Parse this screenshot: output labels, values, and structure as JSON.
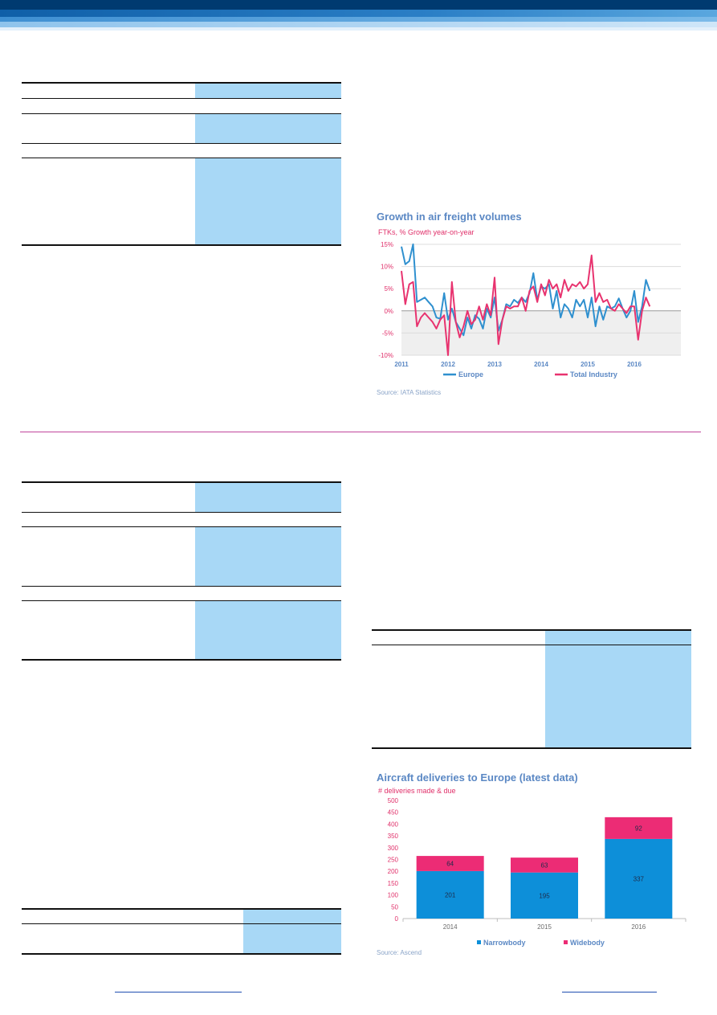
{
  "page_header": {
    "colors": {
      "navy": "#003a70",
      "mid_blue": "#1a6fb8",
      "light_blue": "#56a3dc",
      "pale_blue": "#a9d3f1"
    }
  },
  "freight_chart": {
    "title": "Growth in air freight volumes",
    "subtitle": "FTKs, % Growth year-on-year",
    "source": "Source: IATA Statistics",
    "legend": [
      "Europe",
      "Total Industry"
    ]
  },
  "deliveries_chart": {
    "title": "Aircraft deliveries to Europe (latest data)",
    "subtitle": "# deliveries made & due",
    "source": "Source: Ascend",
    "legend": [
      "Narrowbody",
      "Widebody"
    ]
  },
  "chart_data": [
    {
      "type": "line",
      "title": "Growth in air freight volumes",
      "subtitle": "FTKs, % Growth year-on-year",
      "x_ticks": [
        "2011",
        "2012",
        "2013",
        "2014",
        "2015",
        "2016"
      ],
      "y_ticks": [
        "15%",
        "10%",
        "5%",
        "0%",
        "-5%",
        "-10%"
      ],
      "ylim": [
        -10,
        15
      ],
      "xlim": [
        2011,
        2017
      ],
      "grid": true,
      "legend_position": "bottom",
      "series": [
        {
          "name": "Europe",
          "color": "#2f90cf",
          "values": [
            14.5,
            10.5,
            11.2,
            15.0,
            2.0,
            2.5,
            3.0,
            2.0,
            1.0,
            -1.5,
            -1.8,
            4.0,
            -2.0,
            0.5,
            -2.5,
            -4.0,
            -5.5,
            -1.5,
            -4.0,
            -1.0,
            -1.8,
            -4.0,
            0.5,
            -1.5,
            3.0,
            -4.5,
            -2.0,
            1.5,
            1.0,
            2.5,
            1.8,
            3.0,
            2.0,
            4.0,
            8.5,
            2.5,
            5.5,
            5.0,
            6.0,
            0.5,
            4.5,
            -1.5,
            1.5,
            0.5,
            -1.5,
            2.5,
            1.0,
            2.5,
            -1.5,
            3.0,
            -3.5,
            1.0,
            -2.0,
            1.0,
            0.5,
            1.0,
            2.8,
            0.5,
            -1.5,
            0.0,
            4.5,
            -2.5,
            1.0,
            7.0,
            4.5
          ]
        },
        {
          "name": "Total Industry",
          "color": "#e8336f",
          "values": [
            9.0,
            1.5,
            6.0,
            6.5,
            -3.5,
            -1.5,
            -0.5,
            -1.5,
            -2.5,
            -4.0,
            -2.0,
            -1.0,
            -10.0,
            6.5,
            -2.5,
            -6.0,
            -3.5,
            0.0,
            -3.0,
            -2.0,
            1.0,
            -2.0,
            1.5,
            -1.0,
            7.5,
            -7.5,
            -2.0,
            1.0,
            0.5,
            1.0,
            1.0,
            3.0,
            0.0,
            4.5,
            5.5,
            2.0,
            6.0,
            3.5,
            7.0,
            5.0,
            6.0,
            3.0,
            7.0,
            4.5,
            6.0,
            5.5,
            6.5,
            5.0,
            6.0,
            12.5,
            2.0,
            4.0,
            2.0,
            2.5,
            0.5,
            0.0,
            1.5,
            0.5,
            -0.5,
            1.0,
            1.0,
            -6.5,
            0.0,
            3.0,
            1.0
          ]
        }
      ]
    },
    {
      "type": "bar",
      "stacked": true,
      "title": "Aircraft deliveries to Europe (latest data)",
      "subtitle": "# deliveries made & due",
      "categories": [
        "2014",
        "2015",
        "2016"
      ],
      "y_ticks": [
        "500",
        "450",
        "400",
        "350",
        "300",
        "250",
        "200",
        "150",
        "100",
        "50",
        "0"
      ],
      "ylim": [
        0,
        500
      ],
      "legend_position": "bottom",
      "series": [
        {
          "name": "Narrowbody",
          "color": "#0d8fd9",
          "values": [
            201,
            195,
            337
          ]
        },
        {
          "name": "Widebody",
          "color": "#ec2c75",
          "values": [
            64,
            63,
            92
          ]
        }
      ]
    }
  ]
}
